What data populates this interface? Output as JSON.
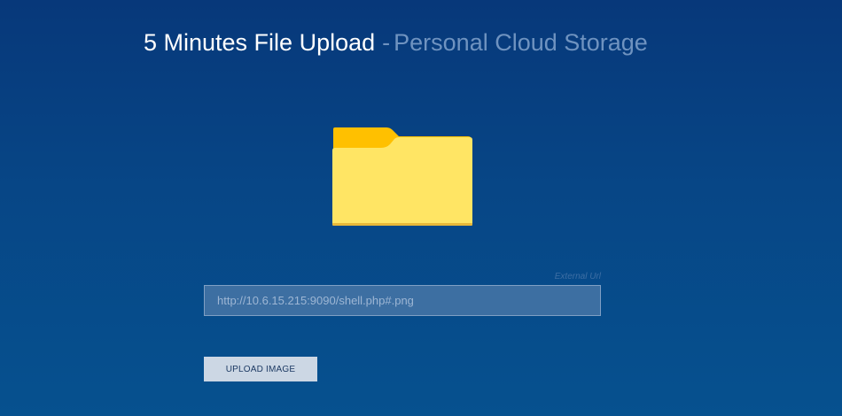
{
  "header": {
    "title": "5 Minutes File Upload",
    "separator": "-",
    "subtitle": "Personal Cloud Storage"
  },
  "upload": {
    "icon": "folder-icon",
    "url_label": "External Url",
    "url_placeholder": "http://10.6.15.215:9090/shell.php#.png",
    "url_value": "",
    "button_label": "UPLOAD IMAGE"
  },
  "colors": {
    "background_top": "#07387a",
    "background_bottom": "#06518f",
    "title": "#ffffff",
    "subtitle": "#6f93c0",
    "folder_front": "#ffe564",
    "folder_back": "#ffc000",
    "button_bg": "#ccd7e4",
    "button_text": "#1d3a63"
  }
}
